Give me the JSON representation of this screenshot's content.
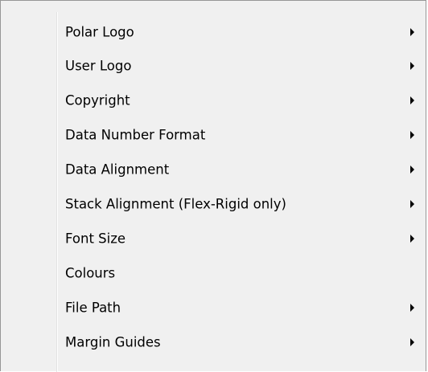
{
  "menu": {
    "items": [
      {
        "label": "Polar Logo",
        "submenu": true
      },
      {
        "label": "User Logo",
        "submenu": true
      },
      {
        "label": "Copyright",
        "submenu": true
      },
      {
        "label": "Data Number Format",
        "submenu": true
      },
      {
        "label": "Data Alignment",
        "submenu": true
      },
      {
        "label": "Stack Alignment (Flex-Rigid only)",
        "submenu": true
      },
      {
        "label": "Font Size",
        "submenu": true
      },
      {
        "label": "Colours",
        "submenu": false
      },
      {
        "label": "File Path",
        "submenu": true
      },
      {
        "label": "Margin Guides",
        "submenu": true
      }
    ]
  }
}
